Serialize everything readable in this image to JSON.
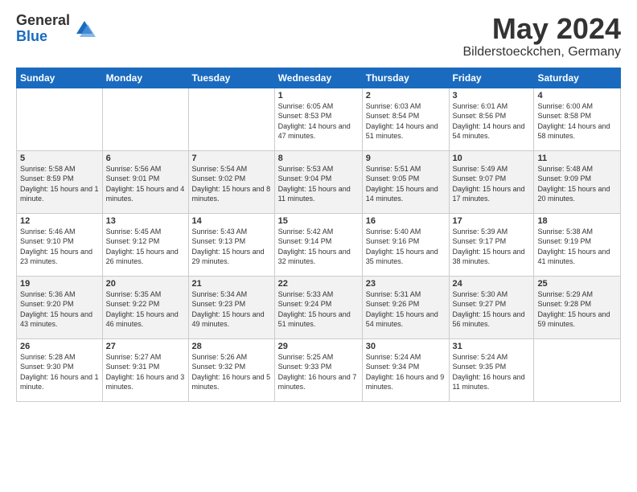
{
  "logo": {
    "general": "General",
    "blue": "Blue"
  },
  "title": "May 2024",
  "location": "Bilderstoeckchen, Germany",
  "headers": [
    "Sunday",
    "Monday",
    "Tuesday",
    "Wednesday",
    "Thursday",
    "Friday",
    "Saturday"
  ],
  "weeks": [
    [
      {
        "day": "",
        "sunrise": "",
        "sunset": "",
        "daylight": ""
      },
      {
        "day": "",
        "sunrise": "",
        "sunset": "",
        "daylight": ""
      },
      {
        "day": "",
        "sunrise": "",
        "sunset": "",
        "daylight": ""
      },
      {
        "day": "1",
        "sunrise": "Sunrise: 6:05 AM",
        "sunset": "Sunset: 8:53 PM",
        "daylight": "Daylight: 14 hours and 47 minutes."
      },
      {
        "day": "2",
        "sunrise": "Sunrise: 6:03 AM",
        "sunset": "Sunset: 8:54 PM",
        "daylight": "Daylight: 14 hours and 51 minutes."
      },
      {
        "day": "3",
        "sunrise": "Sunrise: 6:01 AM",
        "sunset": "Sunset: 8:56 PM",
        "daylight": "Daylight: 14 hours and 54 minutes."
      },
      {
        "day": "4",
        "sunrise": "Sunrise: 6:00 AM",
        "sunset": "Sunset: 8:58 PM",
        "daylight": "Daylight: 14 hours and 58 minutes."
      }
    ],
    [
      {
        "day": "5",
        "sunrise": "Sunrise: 5:58 AM",
        "sunset": "Sunset: 8:59 PM",
        "daylight": "Daylight: 15 hours and 1 minute."
      },
      {
        "day": "6",
        "sunrise": "Sunrise: 5:56 AM",
        "sunset": "Sunset: 9:01 PM",
        "daylight": "Daylight: 15 hours and 4 minutes."
      },
      {
        "day": "7",
        "sunrise": "Sunrise: 5:54 AM",
        "sunset": "Sunset: 9:02 PM",
        "daylight": "Daylight: 15 hours and 8 minutes."
      },
      {
        "day": "8",
        "sunrise": "Sunrise: 5:53 AM",
        "sunset": "Sunset: 9:04 PM",
        "daylight": "Daylight: 15 hours and 11 minutes."
      },
      {
        "day": "9",
        "sunrise": "Sunrise: 5:51 AM",
        "sunset": "Sunset: 9:05 PM",
        "daylight": "Daylight: 15 hours and 14 minutes."
      },
      {
        "day": "10",
        "sunrise": "Sunrise: 5:49 AM",
        "sunset": "Sunset: 9:07 PM",
        "daylight": "Daylight: 15 hours and 17 minutes."
      },
      {
        "day": "11",
        "sunrise": "Sunrise: 5:48 AM",
        "sunset": "Sunset: 9:09 PM",
        "daylight": "Daylight: 15 hours and 20 minutes."
      }
    ],
    [
      {
        "day": "12",
        "sunrise": "Sunrise: 5:46 AM",
        "sunset": "Sunset: 9:10 PM",
        "daylight": "Daylight: 15 hours and 23 minutes."
      },
      {
        "day": "13",
        "sunrise": "Sunrise: 5:45 AM",
        "sunset": "Sunset: 9:12 PM",
        "daylight": "Daylight: 15 hours and 26 minutes."
      },
      {
        "day": "14",
        "sunrise": "Sunrise: 5:43 AM",
        "sunset": "Sunset: 9:13 PM",
        "daylight": "Daylight: 15 hours and 29 minutes."
      },
      {
        "day": "15",
        "sunrise": "Sunrise: 5:42 AM",
        "sunset": "Sunset: 9:14 PM",
        "daylight": "Daylight: 15 hours and 32 minutes."
      },
      {
        "day": "16",
        "sunrise": "Sunrise: 5:40 AM",
        "sunset": "Sunset: 9:16 PM",
        "daylight": "Daylight: 15 hours and 35 minutes."
      },
      {
        "day": "17",
        "sunrise": "Sunrise: 5:39 AM",
        "sunset": "Sunset: 9:17 PM",
        "daylight": "Daylight: 15 hours and 38 minutes."
      },
      {
        "day": "18",
        "sunrise": "Sunrise: 5:38 AM",
        "sunset": "Sunset: 9:19 PM",
        "daylight": "Daylight: 15 hours and 41 minutes."
      }
    ],
    [
      {
        "day": "19",
        "sunrise": "Sunrise: 5:36 AM",
        "sunset": "Sunset: 9:20 PM",
        "daylight": "Daylight: 15 hours and 43 minutes."
      },
      {
        "day": "20",
        "sunrise": "Sunrise: 5:35 AM",
        "sunset": "Sunset: 9:22 PM",
        "daylight": "Daylight: 15 hours and 46 minutes."
      },
      {
        "day": "21",
        "sunrise": "Sunrise: 5:34 AM",
        "sunset": "Sunset: 9:23 PM",
        "daylight": "Daylight: 15 hours and 49 minutes."
      },
      {
        "day": "22",
        "sunrise": "Sunrise: 5:33 AM",
        "sunset": "Sunset: 9:24 PM",
        "daylight": "Daylight: 15 hours and 51 minutes."
      },
      {
        "day": "23",
        "sunrise": "Sunrise: 5:31 AM",
        "sunset": "Sunset: 9:26 PM",
        "daylight": "Daylight: 15 hours and 54 minutes."
      },
      {
        "day": "24",
        "sunrise": "Sunrise: 5:30 AM",
        "sunset": "Sunset: 9:27 PM",
        "daylight": "Daylight: 15 hours and 56 minutes."
      },
      {
        "day": "25",
        "sunrise": "Sunrise: 5:29 AM",
        "sunset": "Sunset: 9:28 PM",
        "daylight": "Daylight: 15 hours and 59 minutes."
      }
    ],
    [
      {
        "day": "26",
        "sunrise": "Sunrise: 5:28 AM",
        "sunset": "Sunset: 9:30 PM",
        "daylight": "Daylight: 16 hours and 1 minute."
      },
      {
        "day": "27",
        "sunrise": "Sunrise: 5:27 AM",
        "sunset": "Sunset: 9:31 PM",
        "daylight": "Daylight: 16 hours and 3 minutes."
      },
      {
        "day": "28",
        "sunrise": "Sunrise: 5:26 AM",
        "sunset": "Sunset: 9:32 PM",
        "daylight": "Daylight: 16 hours and 5 minutes."
      },
      {
        "day": "29",
        "sunrise": "Sunrise: 5:25 AM",
        "sunset": "Sunset: 9:33 PM",
        "daylight": "Daylight: 16 hours and 7 minutes."
      },
      {
        "day": "30",
        "sunrise": "Sunrise: 5:24 AM",
        "sunset": "Sunset: 9:34 PM",
        "daylight": "Daylight: 16 hours and 9 minutes."
      },
      {
        "day": "31",
        "sunrise": "Sunrise: 5:24 AM",
        "sunset": "Sunset: 9:35 PM",
        "daylight": "Daylight: 16 hours and 11 minutes."
      },
      {
        "day": "",
        "sunrise": "",
        "sunset": "",
        "daylight": ""
      }
    ]
  ]
}
